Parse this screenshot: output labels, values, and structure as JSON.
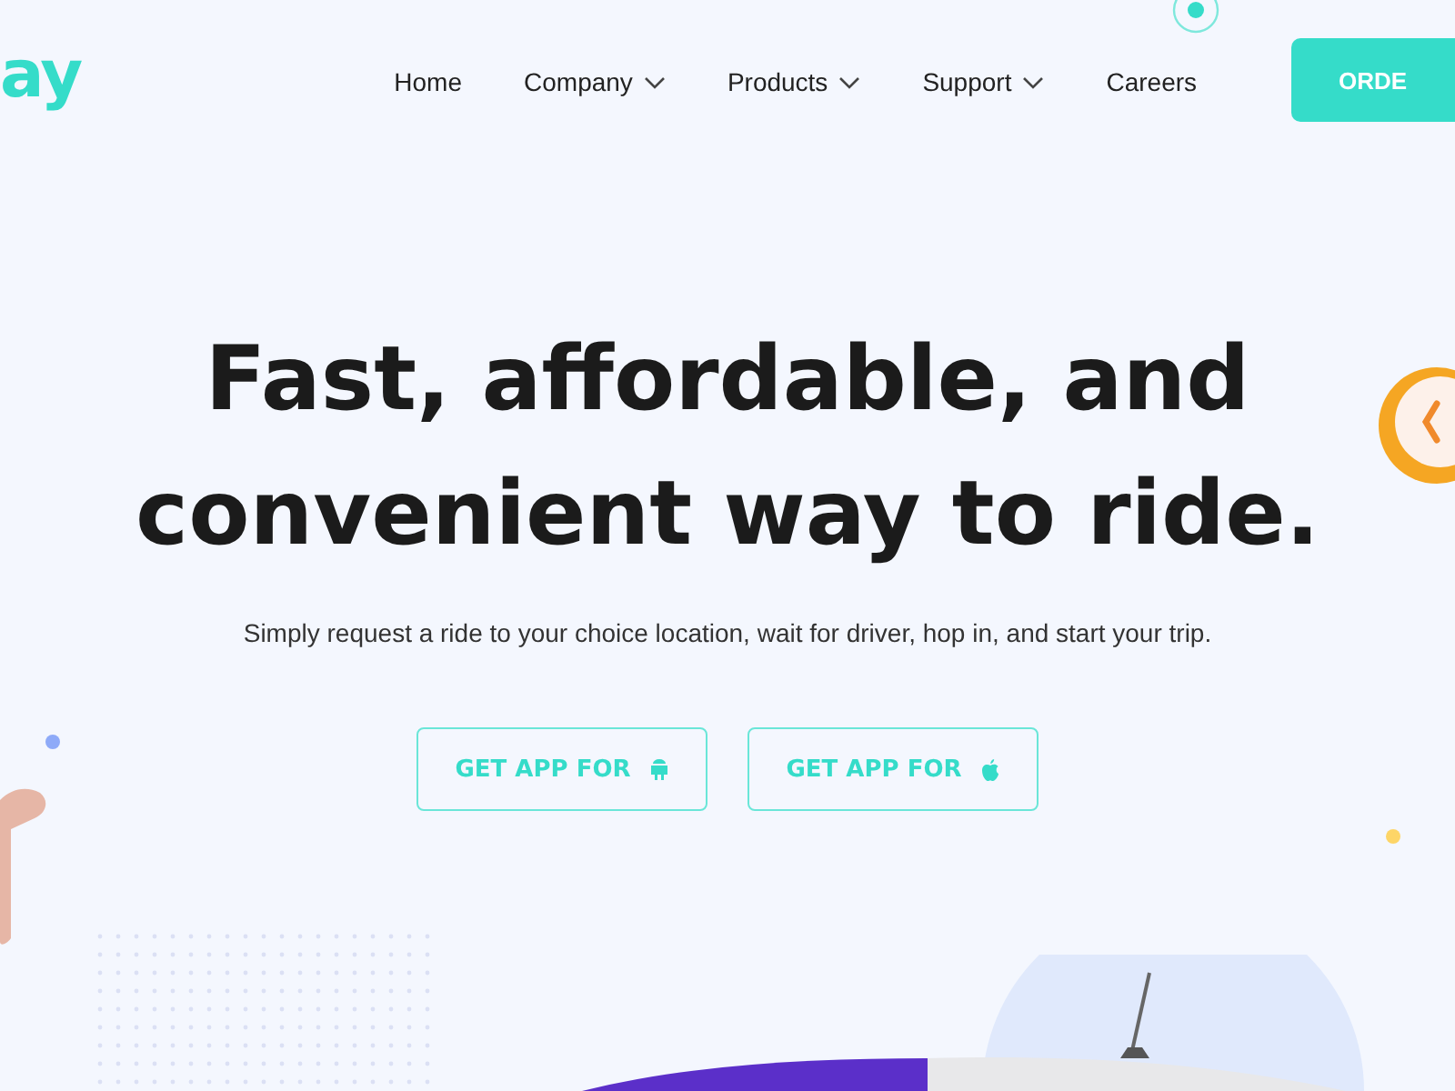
{
  "logo": {
    "text": "ay"
  },
  "nav": [
    {
      "label": "Home",
      "dropdown": false
    },
    {
      "label": "Company",
      "dropdown": true
    },
    {
      "label": "Products",
      "dropdown": true
    },
    {
      "label": "Support",
      "dropdown": true
    },
    {
      "label": "Careers",
      "dropdown": false
    }
  ],
  "order_button": {
    "label": "ORDE"
  },
  "hero": {
    "title_lines": [
      "Fast, affordable, and",
      "convenient way to ride."
    ],
    "subtitle": "Simply request a ride to your choice location, wait for driver, hop in, and start your trip.",
    "buttons": [
      {
        "label": "GET APP FOR",
        "kind": "android"
      },
      {
        "label": "GET APP FOR",
        "kind": "apple"
      }
    ]
  }
}
